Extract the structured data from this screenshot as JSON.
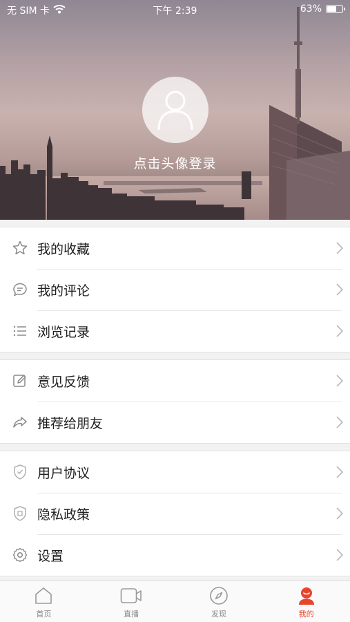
{
  "status_bar": {
    "carrier": "无 SIM 卡",
    "time": "下午 2:39",
    "battery_percent": "63%",
    "battery_level": 0.63,
    "icons": [
      "wifi-icon",
      "battery-icon"
    ]
  },
  "profile": {
    "login_prompt": "点击头像登录",
    "avatar_icon": "user-avatar-icon"
  },
  "menu": {
    "group1": [
      {
        "label": "我的收藏",
        "icon": "star-icon"
      },
      {
        "label": "我的评论",
        "icon": "comment-icon"
      },
      {
        "label": "浏览记录",
        "icon": "list-icon"
      }
    ],
    "group2": [
      {
        "label": "意见反馈",
        "icon": "edit-icon"
      },
      {
        "label": "推荐给朋友",
        "icon": "share-icon"
      }
    ],
    "group3": [
      {
        "label": "用户协议",
        "icon": "shield-check-icon"
      },
      {
        "label": "隐私政策",
        "icon": "shield-private-icon"
      },
      {
        "label": "设置",
        "icon": "gear-icon"
      }
    ]
  },
  "tabbar": {
    "tabs": [
      {
        "label": "首页",
        "icon": "home-icon",
        "active": false
      },
      {
        "label": "直播",
        "icon": "video-icon",
        "active": false
      },
      {
        "label": "发现",
        "icon": "compass-icon",
        "active": false
      },
      {
        "label": "我的",
        "icon": "profile-icon",
        "active": true
      }
    ]
  },
  "colors": {
    "accent": "#e8452c",
    "icon_gray": "#8a8a8a",
    "arrow_gray": "#b8b8b8",
    "background": "#f2f2f2"
  }
}
